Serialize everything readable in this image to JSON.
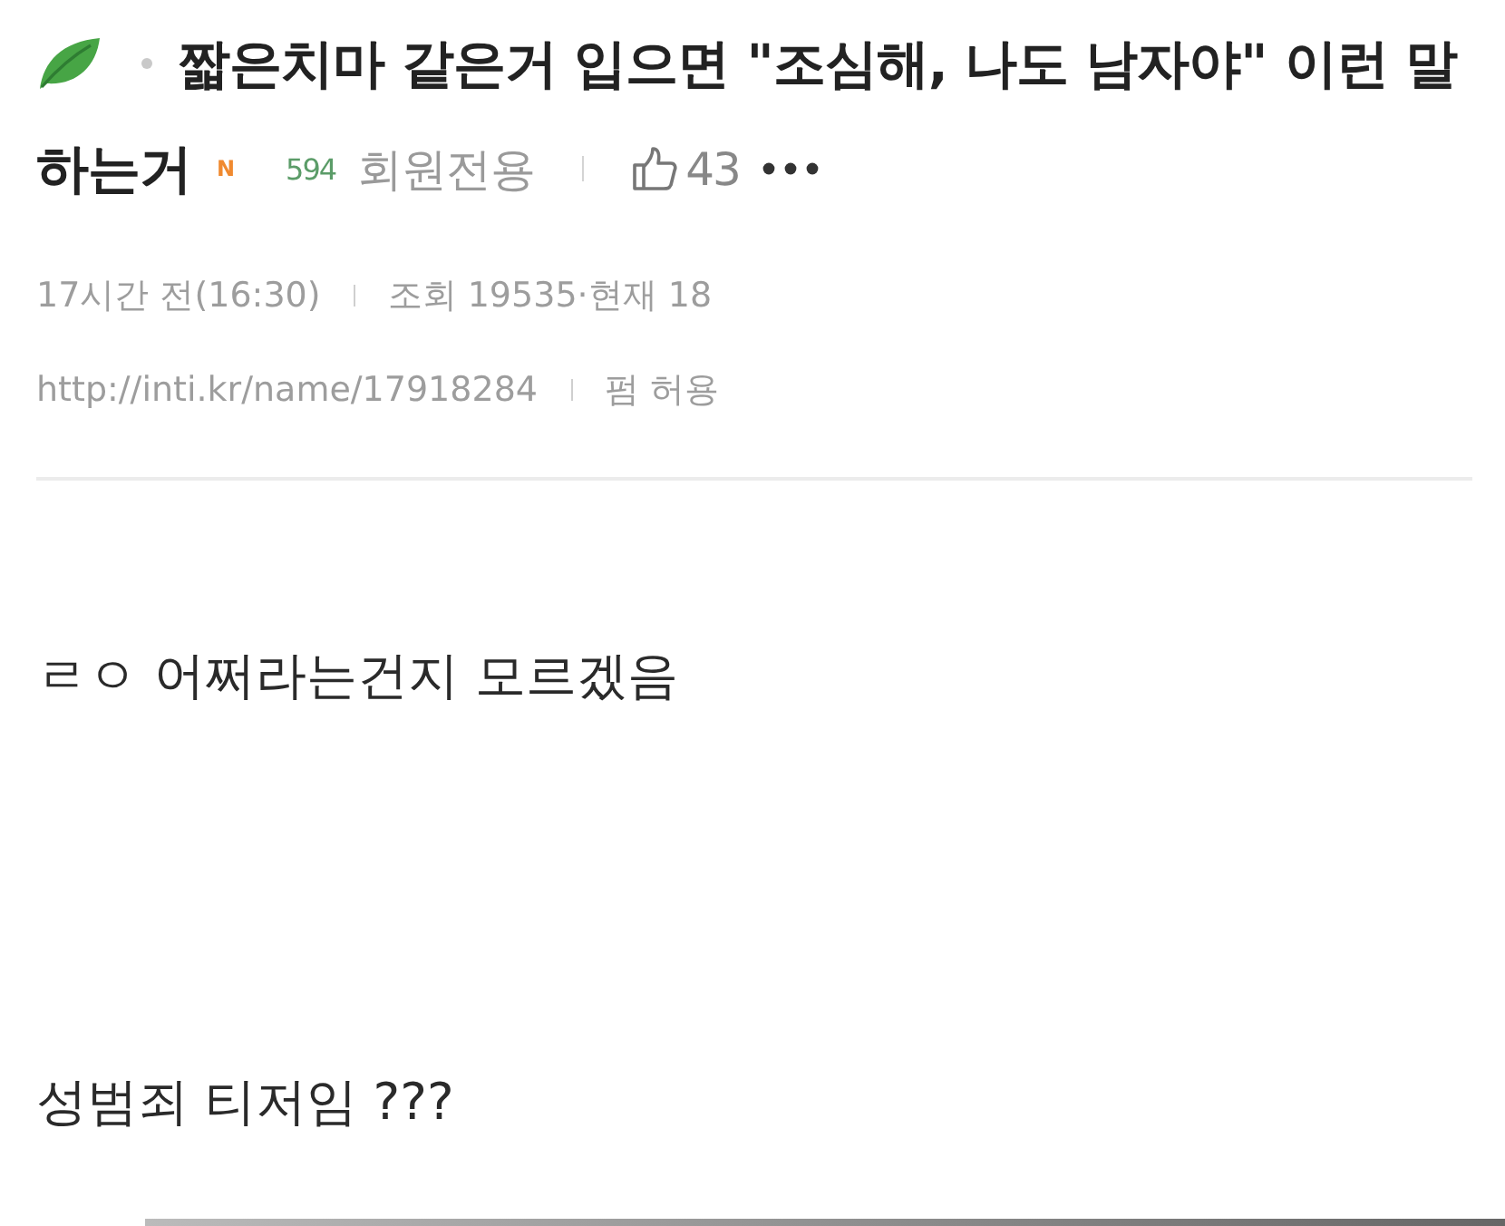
{
  "post": {
    "title_lines": [
      "짧은치마 같은거 입으면 \"조심해, 나도 남자야\" 이런 말",
      "하는거"
    ],
    "badge": "N",
    "author_level": "594",
    "access": "회원전용",
    "likes": "43"
  },
  "meta": {
    "time": "17시간 전(16:30)",
    "views": "조회 19535·현재 18",
    "url": "http://inti.kr/name/17918284",
    "permission": "펌 허용"
  },
  "body": [
    "ㄹㅇ 어쩌라는건지 모르겠음",
    "성범죄 티저임 ???"
  ]
}
